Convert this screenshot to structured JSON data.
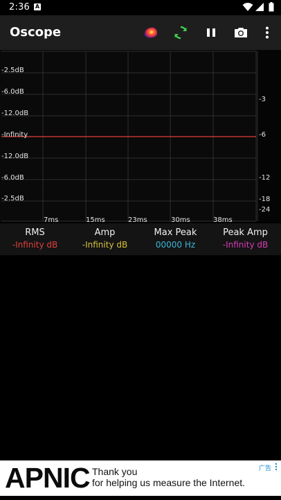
{
  "status_bar": {
    "time": "2:36",
    "notification_glyph": "A",
    "icons": [
      "wifi-icon",
      "signal-icon",
      "battery-icon"
    ]
  },
  "app_bar": {
    "title": "Oscope",
    "actions": [
      "color-palette-icon",
      "refresh-icon",
      "pause-icon",
      "camera-icon",
      "more-vert-icon"
    ],
    "colors": {
      "background": "#1e1e1e",
      "refresh": "#3ecf4a"
    }
  },
  "scope": {
    "left_labels": [
      "-2.5dB",
      "-6.0dB",
      "-12.0dB",
      "-Infinity",
      "-12.0dB",
      "-6.0dB",
      "-2.5dB"
    ],
    "right_labels": [
      "-3",
      "-6",
      "-12",
      "-18",
      "-24"
    ],
    "time_labels": [
      "7ms",
      "15ms",
      "23ms",
      "30ms",
      "38ms"
    ],
    "trace_color": "#e0413b"
  },
  "readouts": [
    {
      "label": "RMS",
      "value": "-Infinity dB",
      "color": "#e0413b"
    },
    {
      "label": "Amp",
      "value": "-Infinity dB",
      "color": "#d8c13c"
    },
    {
      "label": "Max Peak",
      "value": "00000 Hz",
      "color": "#3cb6d8"
    },
    {
      "label": "Peak Amp",
      "value": "-Infinity dB",
      "color": "#d83cb6"
    }
  ],
  "ad": {
    "logo": "APNIC",
    "line1": "Thank you",
    "line2": "for helping us measure the Internet.",
    "label": "广告"
  }
}
